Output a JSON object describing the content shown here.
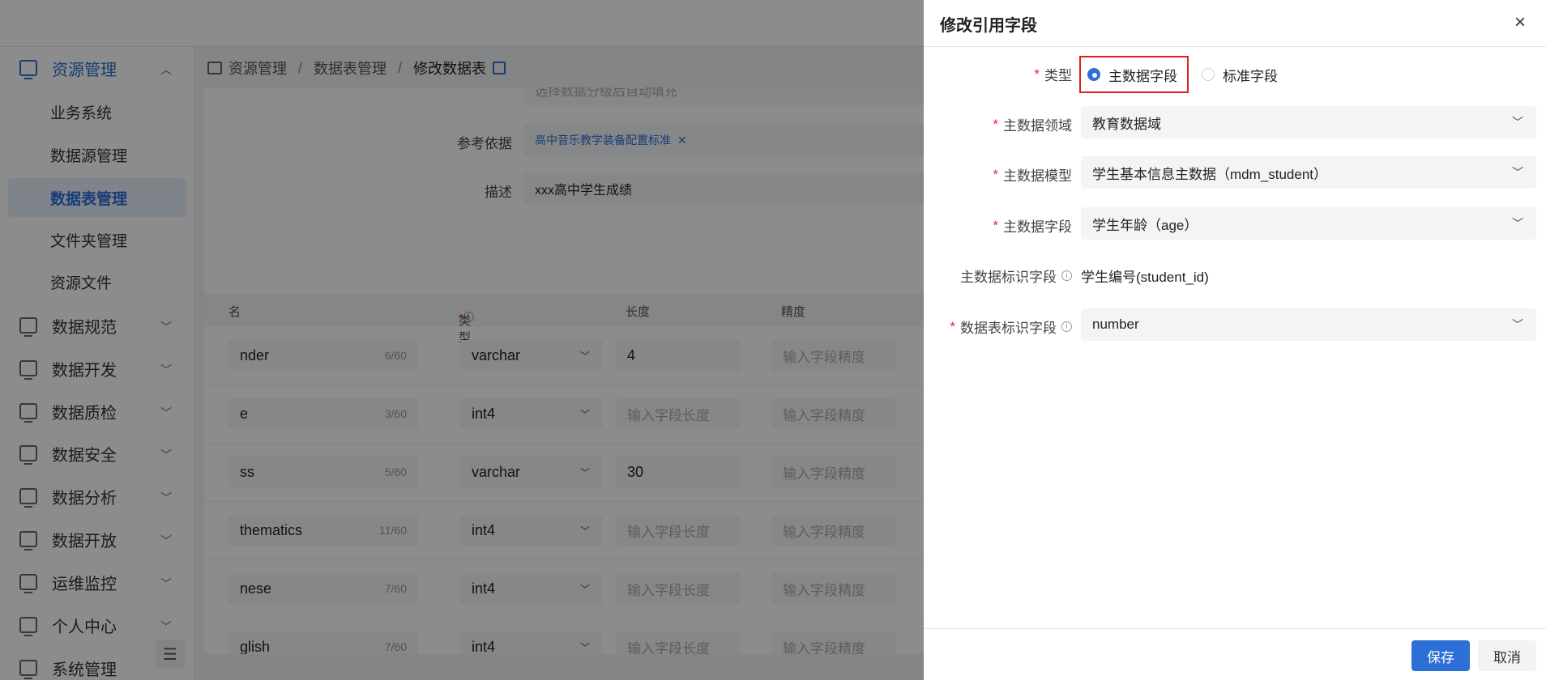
{
  "sidebar": {
    "resource": "资源管理",
    "sub": [
      "业务系统",
      "数据源管理",
      "数据表管理",
      "文件夹管理",
      "资源文件"
    ],
    "groups": [
      "数据规范",
      "数据开发",
      "数据质检",
      "数据安全",
      "数据分析",
      "数据开放",
      "运维监控",
      "个人中心",
      "系统管理"
    ]
  },
  "breadcrumb": {
    "b1": "资源管理",
    "b2": "数据表管理",
    "b3": "修改数据表",
    "sep": "/"
  },
  "form": {
    "share_placeholder": "选择数据分级后自动填充",
    "ref_label": "参考依据",
    "ref_tag": "高中音乐教学装备配置标准",
    "desc_label": "描述",
    "desc_value": "xxx高中学生成绩"
  },
  "grid": {
    "headers": {
      "name": "名",
      "type": "类型",
      "length": "长度",
      "precision": "精度"
    },
    "rows": [
      {
        "name": "nder",
        "count": "6/60",
        "type": "varchar",
        "length": "4",
        "precision": "输入字段精度"
      },
      {
        "name": "e",
        "count": "3/60",
        "type": "int4",
        "length": "输入字段长度",
        "precision": "输入字段精度"
      },
      {
        "name": "ss",
        "count": "5/60",
        "type": "varchar",
        "length": "30",
        "precision": "输入字段精度"
      },
      {
        "name": "thematics",
        "count": "11/60",
        "type": "int4",
        "length": "输入字段长度",
        "precision": "输入字段精度"
      },
      {
        "name": "nese",
        "count": "7/60",
        "type": "int4",
        "length": "输入字段长度",
        "precision": "输入字段精度"
      },
      {
        "name": "glish",
        "count": "7/60",
        "type": "int4",
        "length": "输入字段长度",
        "precision": "输入字段精度"
      }
    ]
  },
  "drawer": {
    "title": "修改引用字段",
    "close": "×",
    "type_label": "类型",
    "type_options": [
      "主数据字段",
      "标准字段"
    ],
    "type_selected": "主数据字段",
    "domain_label": "主数据领域",
    "domain_value": "教育数据域",
    "model_label": "主数据模型",
    "model_value": "学生基本信息主数据（mdm_student）",
    "field_label": "主数据字段",
    "field_value": "学生年龄（age）",
    "id_label": "主数据标识字段",
    "id_value": "学生编号(student_id)",
    "table_id_label": "数据表标识字段",
    "table_id_value": "number",
    "save": "保存",
    "cancel": "取消"
  },
  "icons": [
    "resource-icon",
    "chevron-up-icon",
    "chevron-down-icon",
    "info-icon",
    "close-icon",
    "collapse-icon",
    "book-icon"
  ],
  "colors": {
    "primary": "#2c6fd6",
    "required": "#e23",
    "highlight": "#e0201c"
  }
}
